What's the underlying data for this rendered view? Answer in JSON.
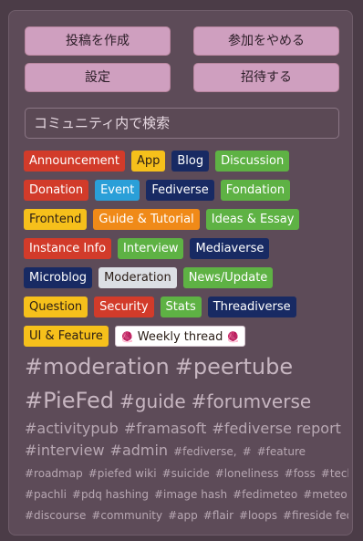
{
  "buttons": {
    "create_post": "投稿を作成",
    "leave": "参加をやめる",
    "settings": "設定",
    "invite": "招待する"
  },
  "search": {
    "placeholder": "コミュニティ内で検索"
  },
  "flairs": [
    {
      "label": "Announcement",
      "bg": "#d23b2a",
      "fg": "#ffffff"
    },
    {
      "label": "App",
      "bg": "#f6c01b",
      "fg": "#2a1d16"
    },
    {
      "label": "Blog",
      "bg": "#182a63",
      "fg": "#ffffff"
    },
    {
      "label": "Discussion",
      "bg": "#5eb244",
      "fg": "#ffffff"
    },
    {
      "label": "Donation",
      "bg": "#d23b2a",
      "fg": "#ffffff"
    },
    {
      "label": "Event",
      "bg": "#2a9fd8",
      "fg": "#ffffff"
    },
    {
      "label": "Fediverse",
      "bg": "#182a63",
      "fg": "#ffffff"
    },
    {
      "label": "Fondation",
      "bg": "#5eb244",
      "fg": "#ffffff"
    },
    {
      "label": "Frontend",
      "bg": "#f6c01b",
      "fg": "#2a1d16"
    },
    {
      "label": "Guide & Tutorial",
      "bg": "#f08a18",
      "fg": "#ffffff"
    },
    {
      "label": "Ideas & Essay",
      "bg": "#5eb244",
      "fg": "#ffffff"
    },
    {
      "label": "Instance Info",
      "bg": "#d23b2a",
      "fg": "#ffffff"
    },
    {
      "label": "Interview",
      "bg": "#5eb244",
      "fg": "#ffffff"
    },
    {
      "label": "Mediaverse",
      "bg": "#182a63",
      "fg": "#ffffff"
    },
    {
      "label": "Microblog",
      "bg": "#182a63",
      "fg": "#ffffff"
    },
    {
      "label": "Moderation",
      "bg": "#dcdfe4",
      "fg": "#2a1d16"
    },
    {
      "label": "News/Update",
      "bg": "#5eb244",
      "fg": "#ffffff"
    },
    {
      "label": "Question",
      "bg": "#f6c01b",
      "fg": "#2a1d16"
    },
    {
      "label": "Security",
      "bg": "#d23b2a",
      "fg": "#ffffff"
    },
    {
      "label": "Stats",
      "bg": "#5eb244",
      "fg": "#ffffff"
    },
    {
      "label": "Threadiverse",
      "bg": "#182a63",
      "fg": "#ffffff"
    },
    {
      "label": "UI & Feature",
      "bg": "#f6c01b",
      "fg": "#2a1d16"
    },
    {
      "label": "Weekly thread",
      "bg": "#ffffff",
      "fg": "#2a1d16",
      "emoji": "🧶"
    }
  ],
  "tag_cloud": [
    [
      {
        "text": "#moderation",
        "size": 24
      },
      {
        "text": "#peertube",
        "size": 24
      }
    ],
    [
      {
        "text": "#PieFed",
        "size": 24
      },
      {
        "text": "#guide",
        "size": 20
      },
      {
        "text": "#forumverse",
        "size": 20
      }
    ],
    [
      {
        "text": "#activitypub",
        "size": 16
      },
      {
        "text": "#framasoft",
        "size": 16
      },
      {
        "text": "#fediverse report",
        "size": 16
      }
    ],
    [
      {
        "text": "#interview",
        "size": 16
      },
      {
        "text": "#admin",
        "size": 16
      },
      {
        "text": "#fediverse,",
        "size": 12
      },
      {
        "text": "#",
        "size": 12
      },
      {
        "text": "#feature",
        "size": 12
      }
    ],
    [
      {
        "text": "#roadmap",
        "size": 12
      },
      {
        "text": "#piefed wiki",
        "size": 12
      },
      {
        "text": "#suicide",
        "size": 12
      },
      {
        "text": "#loneliness",
        "size": 12
      },
      {
        "text": "#foss",
        "size": 12
      },
      {
        "text": "#tech",
        "size": 12
      }
    ],
    [
      {
        "text": "#pachli",
        "size": 12
      },
      {
        "text": "#pdq hashing",
        "size": 12
      },
      {
        "text": "#image hash",
        "size": 12
      },
      {
        "text": "#fedimeteo",
        "size": 12
      },
      {
        "text": "#meteo",
        "size": 12
      }
    ],
    [
      {
        "text": "#discourse",
        "size": 12
      },
      {
        "text": "#community",
        "size": 12
      },
      {
        "text": "#app",
        "size": 12
      },
      {
        "text": "#flair",
        "size": 12
      },
      {
        "text": "#loops",
        "size": 12
      },
      {
        "text": "#fireside fedi",
        "size": 12
      }
    ]
  ]
}
